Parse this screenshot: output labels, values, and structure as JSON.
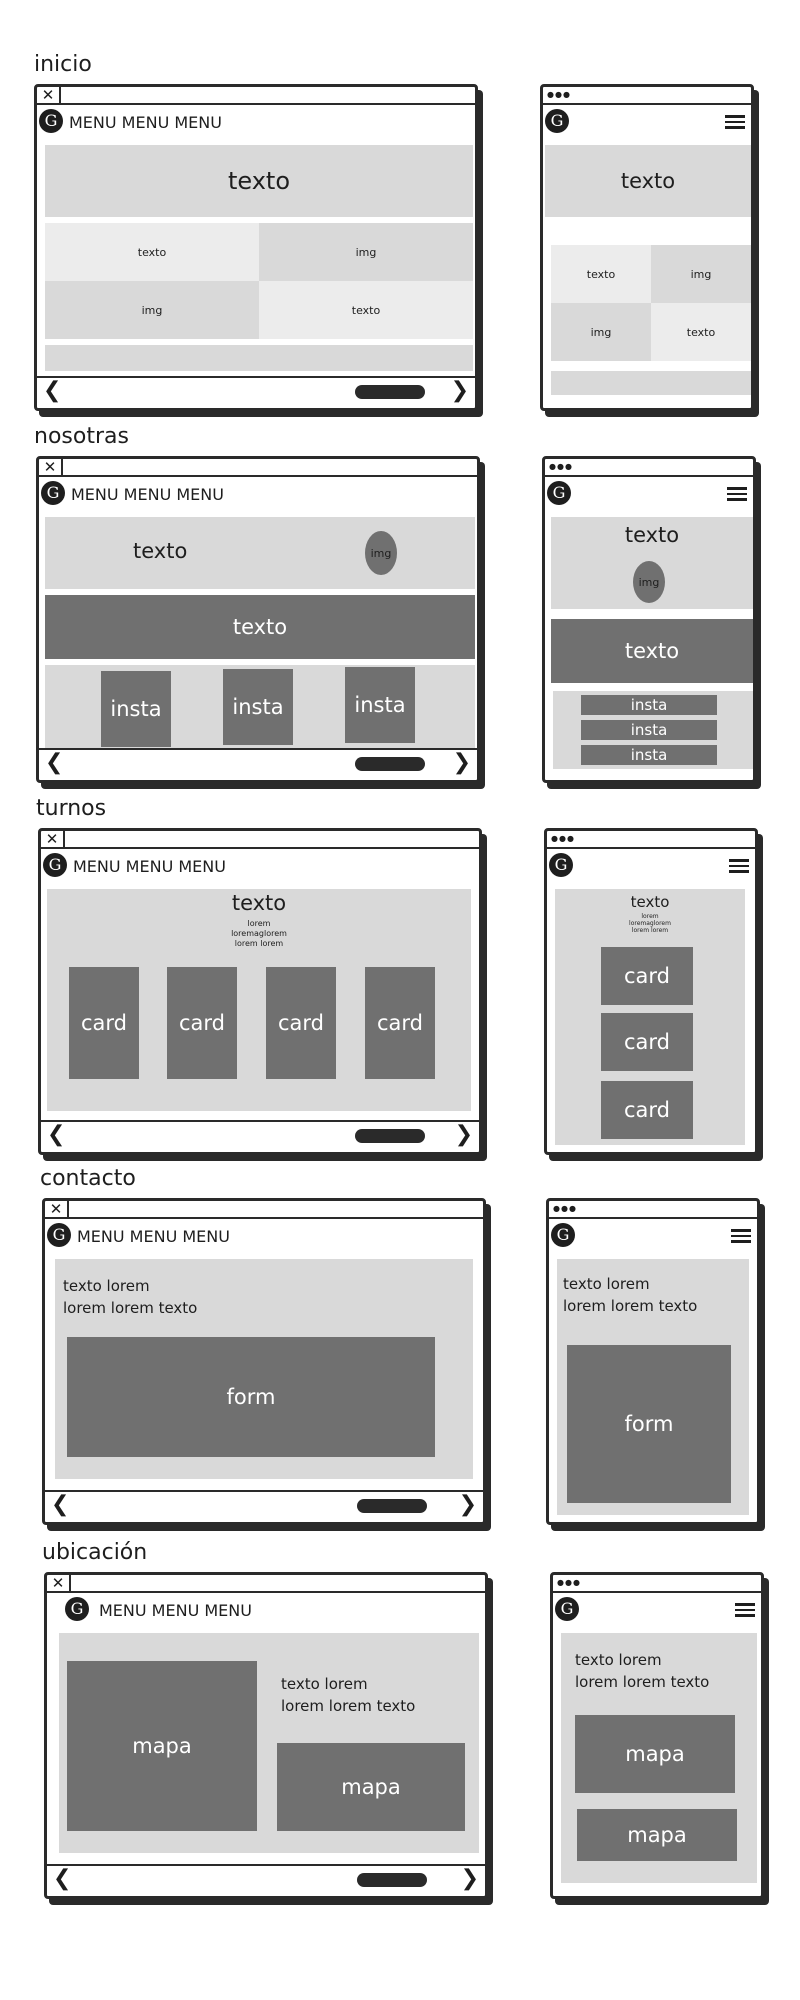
{
  "sections": {
    "inicio": "inicio",
    "nosotras": "nosotras",
    "turnos": "turnos",
    "contacto": "contacto",
    "ubicacion": "ubicación"
  },
  "common": {
    "menu": "MENU MENU MENU",
    "logo": "G",
    "close": "✕",
    "dots": "●●●",
    "prev": "❮",
    "next": "❯"
  },
  "labels": {
    "texto": "texto",
    "img": "img",
    "insta": "insta",
    "card": "card",
    "form": "form",
    "mapa": "mapa",
    "lorem": "lorem",
    "loremagl": "loremaglorem",
    "lorem_lorem": "lorem lorem",
    "texto_lorem": "texto lorem",
    "lorem_lorem_texto": "lorem lorem texto"
  }
}
